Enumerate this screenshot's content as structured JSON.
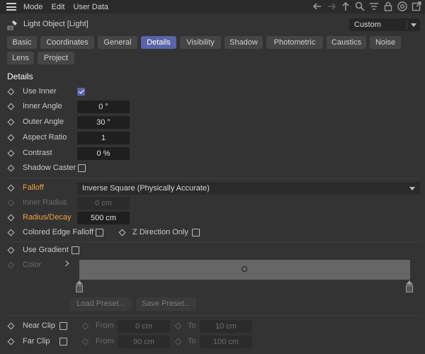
{
  "menubar": {
    "items": [
      "Mode",
      "Edit",
      "User Data"
    ],
    "icons": [
      "back-arrow-icon",
      "forward-arrow-icon",
      "up-arrow-icon",
      "search-icon",
      "filter-icon",
      "lock-icon",
      "target-icon",
      "new-window-icon"
    ]
  },
  "object": {
    "title": "Light Object [Light]",
    "icon": "light-icon",
    "preset": "Custom"
  },
  "tabs": [
    "Basic",
    "Coordinates",
    "General",
    "Details",
    "Visibility",
    "Shadow",
    "Photometric",
    "Caustics",
    "Noise",
    "Lens",
    "Project"
  ],
  "active_tab": "Details",
  "section": {
    "title": "Details"
  },
  "details": {
    "use_inner": {
      "label": "Use Inner",
      "checked": true
    },
    "inner_angle": {
      "label": "Inner Angle",
      "value": "0 °"
    },
    "outer_angle": {
      "label": "Outer Angle",
      "value": "30 °"
    },
    "aspect_ratio": {
      "label": "Aspect Ratio",
      "value": "1"
    },
    "contrast": {
      "label": "Contrast",
      "value": "0 %"
    },
    "shadow_caster": {
      "label": "Shadow Caster",
      "checked": false
    }
  },
  "falloff": {
    "label": "Falloff",
    "value": "Inverse Square (Physically Accurate)",
    "inner_radius": {
      "label": "Inner Radius",
      "value": "0 cm"
    },
    "radius_decay": {
      "label": "Radius/Decay",
      "value": "500 cm"
    },
    "colored_edge": {
      "label": "Colored Edge Falloff",
      "checked": false
    },
    "z_direction": {
      "label": "Z Direction Only",
      "checked": false
    }
  },
  "gradient": {
    "use_gradient": {
      "label": "Use Gradient",
      "checked": false
    },
    "color_label": "Color",
    "load_preset": "Load Preset...",
    "save_preset": "Save Preset..."
  },
  "clip": {
    "near": {
      "label": "Near Clip",
      "from_label": "From",
      "from": "0 cm",
      "to_label": "To",
      "to": "10 cm",
      "checked": false
    },
    "far": {
      "label": "Far Clip",
      "from_label": "From",
      "from": "90 cm",
      "to_label": "To",
      "to": "100 cm",
      "checked": false
    }
  },
  "colors": {
    "accent": "#5b64a8",
    "highlight_label": "#f0a040",
    "background": "#333333"
  }
}
